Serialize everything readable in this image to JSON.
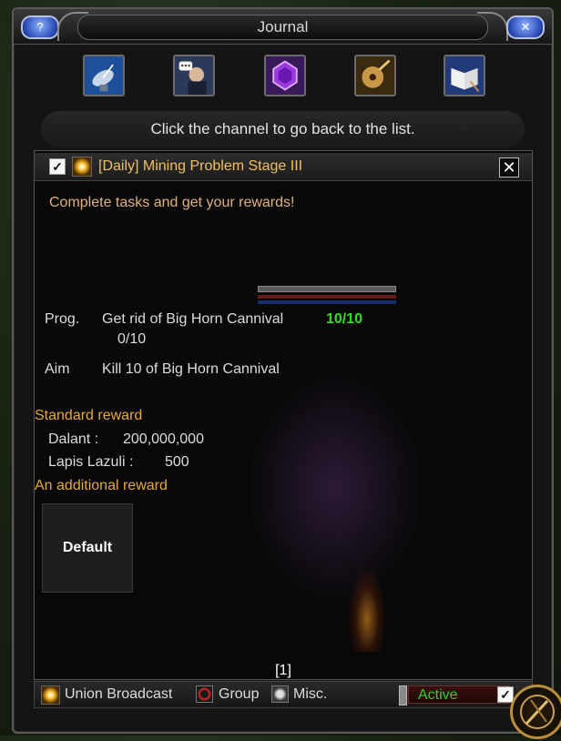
{
  "window": {
    "title": "Journal"
  },
  "toolbar": {
    "icons": [
      {
        "name": "satellite-dish"
      },
      {
        "name": "chat-character"
      },
      {
        "name": "purple-gem"
      },
      {
        "name": "lute"
      },
      {
        "name": "spellbook"
      }
    ]
  },
  "notice": "Click the channel to go back to the list.",
  "quest": {
    "title": "[Daily] Mining Problem Stage III",
    "checked": true,
    "description": "Complete tasks and get your rewards!",
    "progress": {
      "label": "Prog.",
      "task": "Get rid of Big Horn Cannival",
      "current_count": "10/10",
      "sub_count": "0/10"
    },
    "aim": {
      "label": "Aim",
      "text": "Kill 10 of Big Horn Cannival"
    }
  },
  "rewards": {
    "standard_heading": "Standard reward",
    "items": [
      {
        "label": "Dalant :",
        "value": "200,000,000"
      },
      {
        "label": "Lapis Lazuli :",
        "value": "500"
      }
    ],
    "additional_heading": "An additional reward",
    "default_button": "Default"
  },
  "pagination": {
    "page": "[1]"
  },
  "filters": {
    "union_broadcast": "Union Broadcast",
    "group": "Group",
    "misc": "Misc.",
    "status": "Active",
    "status_checked": true
  },
  "colors": {
    "quest_title": "#f0c060",
    "reward_heading": "#e8a838",
    "progress_complete": "#33dd22",
    "active_text": "#2fd02f"
  }
}
